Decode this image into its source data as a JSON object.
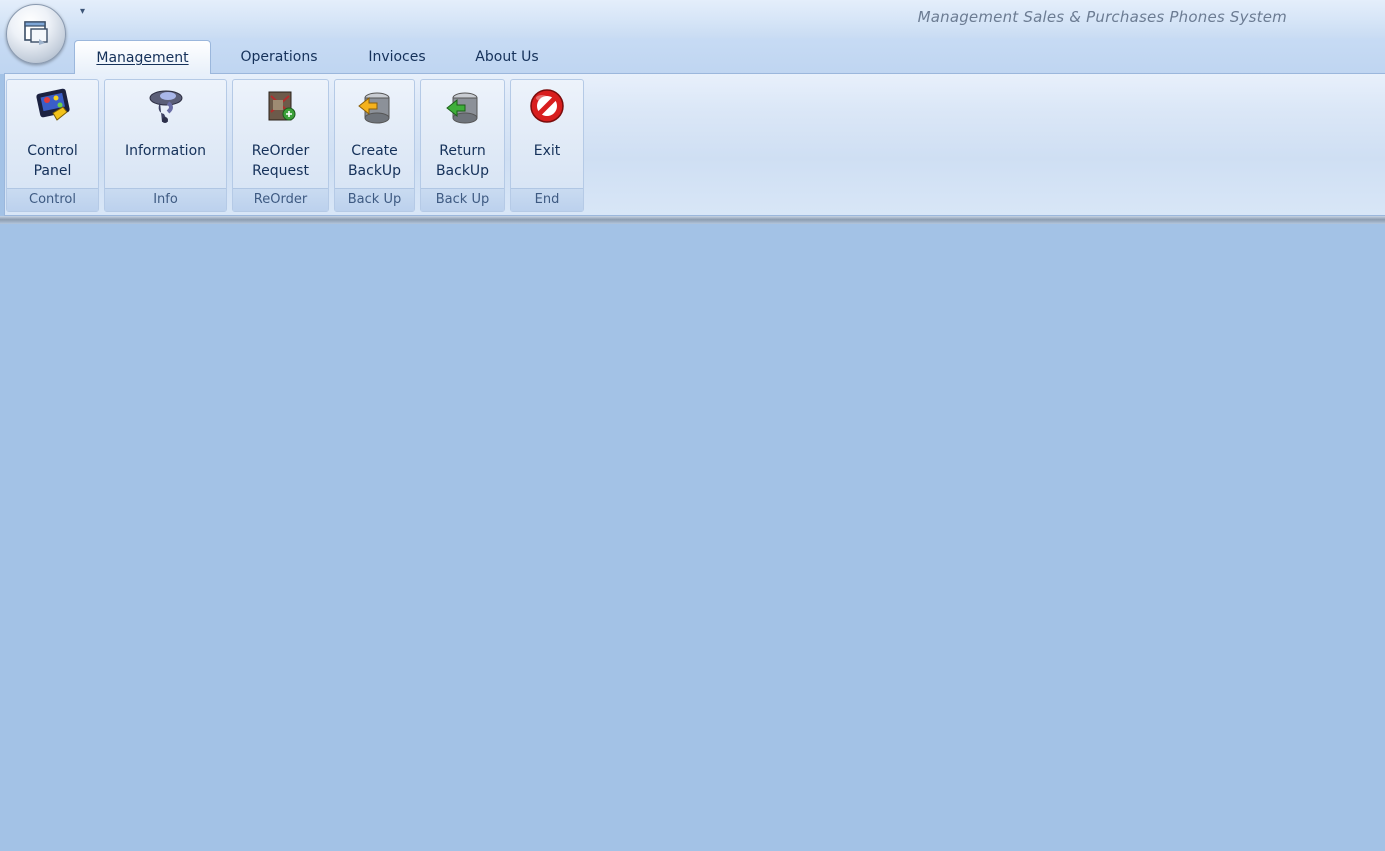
{
  "window": {
    "title": "Management Sales & Purchases Phones System",
    "qat_icon": "dropdown-arrow-icon"
  },
  "tabs": [
    {
      "label": "Management",
      "active": true
    },
    {
      "label": "Operations",
      "active": false
    },
    {
      "label": "Invioces",
      "active": false
    },
    {
      "label": "About Us",
      "active": false
    }
  ],
  "ribbon": {
    "groups": [
      {
        "label": "Control",
        "button": {
          "line1": "Control",
          "line2": "Panel",
          "icon": "control-panel-icon"
        }
      },
      {
        "label": "Info",
        "button": {
          "line1": "Information",
          "line2": "",
          "icon": "information-icon"
        }
      },
      {
        "label": "ReOrder",
        "button": {
          "line1": "ReOrder",
          "line2": "Request",
          "icon": "reorder-request-icon"
        }
      },
      {
        "label": "Back Up",
        "button": {
          "line1": "Create",
          "line2": "BackUp",
          "icon": "create-backup-icon"
        }
      },
      {
        "label": "Back Up",
        "button": {
          "line1": "Return",
          "line2": "BackUp",
          "icon": "return-backup-icon"
        }
      },
      {
        "label": "End",
        "button": {
          "line1": "Exit",
          "line2": "",
          "icon": "exit-icon"
        }
      }
    ]
  },
  "colors": {
    "workspace": "#a3c2e6",
    "tab_text": "#15315a",
    "group_label_text": "#3e5a82"
  }
}
